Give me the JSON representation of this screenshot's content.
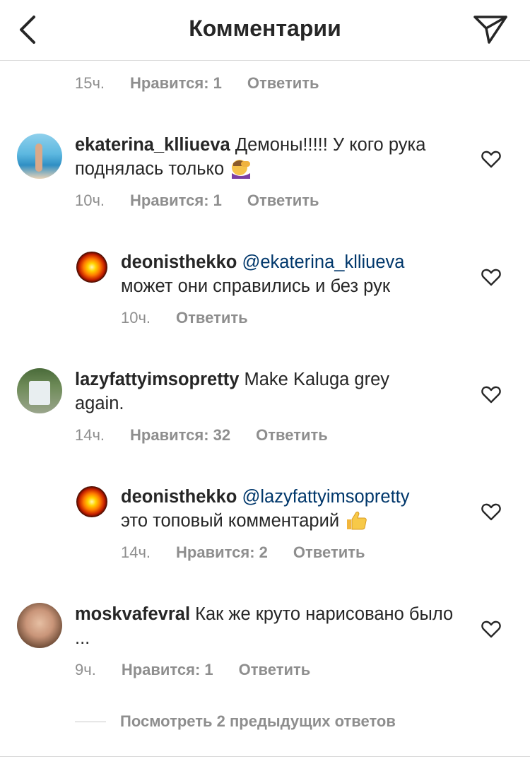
{
  "header": {
    "title": "Комментарии",
    "back_icon": "chevron-left-icon",
    "send_icon": "paper-plane-icon"
  },
  "top_meta": {
    "time": "15ч.",
    "likes": "Нравится: 1",
    "reply": "Ответить"
  },
  "comments": [
    {
      "username": "ekaterina_klliueva",
      "text": "Демоны!!!!! У кого рука поднялась только",
      "emoji": "face-palm-emoji",
      "time": "10ч.",
      "likes": "Нравится: 1",
      "reply": "Ответить"
    },
    {
      "username": "deonisthekko",
      "mention": "@ekaterina_klliueva",
      "text": "может они справились и без рук",
      "time": "10ч.",
      "reply": "Ответить"
    },
    {
      "username": "lazyfattyimsopretty",
      "text": "Make Kaluga grey again.",
      "time": "14ч.",
      "likes": "Нравится: 32",
      "reply": "Ответить"
    },
    {
      "username": "deonisthekko",
      "mention": "@lazyfattyimsopretty",
      "text": "это топовый комментарий",
      "emoji": "thumbs-up-emoji",
      "time": "14ч.",
      "likes": "Нравится: 2",
      "reply": "Ответить"
    },
    {
      "username": "moskvafevral",
      "text": "Как же круто нарисовано было ...",
      "time": "9ч.",
      "likes": "Нравится: 1",
      "reply": "Ответить"
    }
  ],
  "view_replies": "Посмотреть 2 предыдущих ответов",
  "colors": {
    "text": "#262626",
    "meta": "#8e8e8e",
    "mention": "#00376b",
    "divider": "#dbdbdb"
  }
}
